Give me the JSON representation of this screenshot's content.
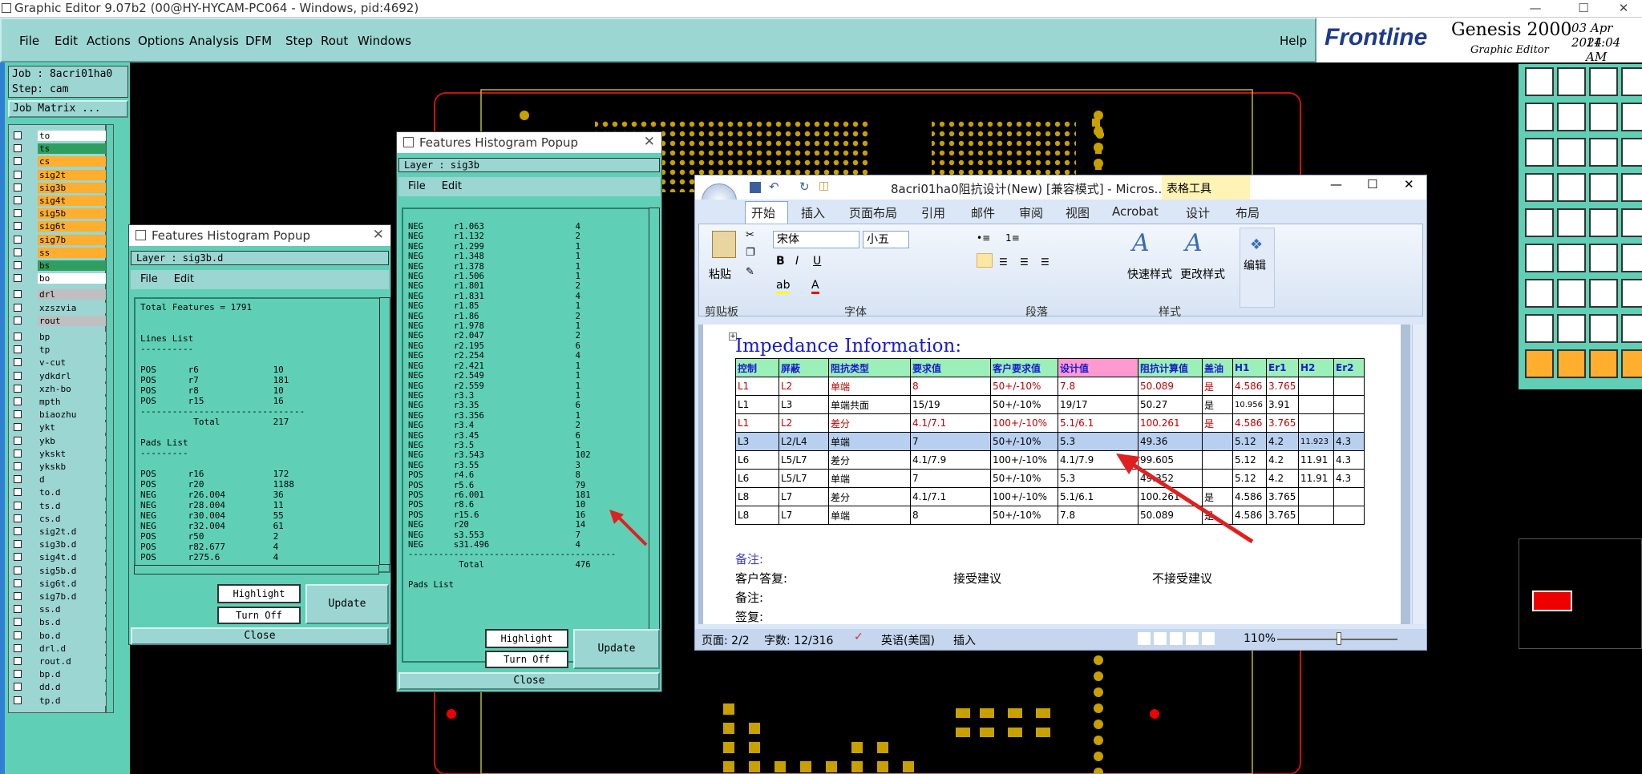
{
  "window": {
    "title": "Graphic Editor 9.07b2 (00@HY-HYCAM-PC064 - Windows, pid:4692)"
  },
  "menu": [
    "File",
    "Edit",
    "Actions",
    "Options",
    "Analysis",
    "DFM",
    "Step",
    "Rout",
    "Windows"
  ],
  "help": "Help",
  "brand": {
    "logo": "Frontline",
    "product": "Genesis 2000",
    "sub": "Graphic Editor",
    "date": "03 Apr 2024",
    "time": "11:04 AM"
  },
  "job": {
    "job_line": "Job : 8acri01ha0",
    "step_line": "Step: cam",
    "matrix_button": "Job Matrix ..."
  },
  "layers": [
    {
      "name": "to",
      "color": "#ffffff"
    },
    {
      "name": "ts",
      "color": "#2e9f60"
    },
    {
      "name": "cs",
      "color": "#ffae2e"
    },
    {
      "name": "sig2t",
      "color": "#ffae2e"
    },
    {
      "name": "sig3b",
      "color": "#ffae2e"
    },
    {
      "name": "sig4t",
      "color": "#ffae2e"
    },
    {
      "name": "sig5b",
      "color": "#ffae2e"
    },
    {
      "name": "sig6t",
      "color": "#ffae2e"
    },
    {
      "name": "sig7b",
      "color": "#ffae2e"
    },
    {
      "name": "ss",
      "color": "#ffae2e"
    },
    {
      "name": "bs",
      "color": "#2e9f60"
    },
    {
      "name": "bo",
      "color": "#ffffff"
    },
    {
      "name": "drl",
      "color": "#bfbfbf"
    },
    {
      "name": "xzszvia",
      "color": "#9bd6d3"
    },
    {
      "name": "rout",
      "color": "#bfbfbf"
    },
    {
      "name": "bp",
      "color": "#9bd6d3"
    },
    {
      "name": "tp",
      "color": "#9bd6d3"
    },
    {
      "name": "v-cut",
      "color": "#9bd6d3"
    },
    {
      "name": "ydkdrl",
      "color": "#9bd6d3"
    },
    {
      "name": "xzh-bo",
      "color": "#9bd6d3"
    },
    {
      "name": "mpth",
      "color": "#9bd6d3"
    },
    {
      "name": "biaozhu",
      "color": "#9bd6d3"
    },
    {
      "name": "ykt",
      "color": "#9bd6d3"
    },
    {
      "name": "ykb",
      "color": "#9bd6d3"
    },
    {
      "name": "ykskt",
      "color": "#9bd6d3"
    },
    {
      "name": "ykskb",
      "color": "#9bd6d3"
    },
    {
      "name": "d",
      "color": "#9bd6d3"
    },
    {
      "name": "to.d",
      "color": "#9bd6d3"
    },
    {
      "name": "ts.d",
      "color": "#9bd6d3"
    },
    {
      "name": "cs.d",
      "color": "#9bd6d3"
    },
    {
      "name": "sig2t.d",
      "color": "#9bd6d3"
    },
    {
      "name": "sig3b.d",
      "color": "#9bd6d3"
    },
    {
      "name": "sig4t.d",
      "color": "#9bd6d3"
    },
    {
      "name": "sig5b.d",
      "color": "#9bd6d3"
    },
    {
      "name": "sig6t.d",
      "color": "#9bd6d3"
    },
    {
      "name": "sig7b.d",
      "color": "#9bd6d3"
    },
    {
      "name": "ss.d",
      "color": "#9bd6d3"
    },
    {
      "name": "bs.d",
      "color": "#9bd6d3"
    },
    {
      "name": "bo.d",
      "color": "#9bd6d3"
    },
    {
      "name": "drl.d",
      "color": "#9bd6d3"
    },
    {
      "name": "rout.d",
      "color": "#9bd6d3"
    },
    {
      "name": "bp.d",
      "color": "#9bd6d3"
    },
    {
      "name": "dd.d",
      "color": "#9bd6d3"
    },
    {
      "name": "tp.d",
      "color": "#9bd6d3"
    }
  ],
  "popup1": {
    "title": "Features Histogram Popup",
    "layer": "Layer :  sig3b.d",
    "file": "File",
    "edit": "Edit",
    "content": "Total Features = 1791\n\n\nLines List\n----------\n\nPOS      r6              10\nPOS      r7              181\nPOS      r8              10\nPOS      r15             16\n-------------------------------\n          Total          217\n\nPads List\n---------\n\nPOS      r16             172\nPOS      r20             1188\nNEG      r26.004         36\nNEG      r28.004         11\nNEG      r30.004         55\nNEG      r32.004         61\nPOS      r50             2\nPOS      r82.677         4\nPOS      r275.6          4",
    "highlight": "Highlight",
    "turnoff": "Turn Off",
    "update": "Update",
    "close": "Close"
  },
  "popup2": {
    "title": "Features Histogram Popup",
    "layer": "Layer :  sig3b",
    "file": "File",
    "edit": "Edit",
    "content": "NEG      r1.063                  4\nNEG      r1.132                  2\nNEG      r1.299                  1\nNEG      r1.348                  1\nNEG      r1.378                  1\nNEG      r1.506                  1\nNEG      r1.801                  2\nNEG      r1.831                  4\nNEG      r1.85                   1\nNEG      r1.86                   2\nNEG      r1.978                  1\nNEG      r2.047                  2\nNEG      r2.195                  6\nNEG      r2.254                  4\nNEG      r2.421                  1\nNEG      r2.549                  1\nNEG      r2.559                  1\nNEG      r3.3                    1\nNEG      r3.35                   6\nNEG      r3.356                  1\nNEG      r3.4                    2\nNEG      r3.45                   6\nNEG      r3.5                    1\nNEG      r3.543                  102\nNEG      r3.55                   3\nPOS      r4.6                    8\nPOS      r5.6                    79\nPOS      r6.001                  181\nPOS      r8.6                    10\nPOS      r15.6                   16\nNEG      r20                     14\nNEG      s3.553                  7\nNEG      s31.496                 4\n-----------------------------------------\n          Total                  476\n\nPads List",
    "highlight": "Highlight",
    "turnoff": "Turn Off",
    "update": "Update",
    "close": "Close"
  },
  "word": {
    "title": "8acri01ha0阻抗设计(New) [兼容模式] - Micros...",
    "context_tab": "表格工具",
    "tabs": [
      "开始",
      "插入",
      "页面布局",
      "引用",
      "邮件",
      "审阅",
      "视图",
      "Acrobat",
      "设计",
      "布局"
    ],
    "font_name": "宋体",
    "font_size": "小五",
    "paste": "粘贴",
    "quick_style": "快速样式",
    "change_style": "更改样式",
    "edit_label": "编辑",
    "groups": [
      "剪贴板",
      "字体",
      "段落",
      "样式"
    ],
    "heading": "Impedance Information:",
    "table_headers": [
      "控制",
      "屏蔽",
      "阻抗类型",
      "要求值",
      "客户要求值",
      "设计值",
      "阻抗计算值",
      "盖油",
      "H1",
      "Er1",
      "H2",
      "Er2"
    ],
    "table_rows": [
      [
        "L1",
        "L2",
        "单端",
        "8",
        "50+/-10%",
        "7.8",
        "50.089",
        "是",
        "4.586",
        "3.765",
        "",
        ""
      ],
      [
        "L1",
        "L3",
        "单端共面",
        "15/19",
        "50+/-10%",
        "19/17",
        "50.27",
        "是",
        "10.956",
        "3.91",
        "",
        ""
      ],
      [
        "L1",
        "L2",
        "差分",
        "4.1/7.1",
        "100+/-10%",
        "5.1/6.1",
        "100.261",
        "是",
        "4.586",
        "3.765",
        "",
        ""
      ],
      [
        "L3",
        "L2/L4",
        "单端",
        "7",
        "50+/-10%",
        "5.3",
        "49.36",
        "",
        "5.12",
        "4.2",
        "11.923",
        "4.3"
      ],
      [
        "L6",
        "L5/L7",
        "差分",
        "4.1/7.9",
        "100+/-10%",
        "4.1/7.9",
        "99.605",
        "",
        "5.12",
        "4.2",
        "11.91",
        "4.3"
      ],
      [
        "L6",
        "L5/L7",
        "单端",
        "7",
        "50+/-10%",
        "5.3",
        "49.352",
        "",
        "5.12",
        "4.2",
        "11.91",
        "4.3"
      ],
      [
        "L8",
        "L7",
        "差分",
        "4.1/7.1",
        "100+/-10%",
        "5.1/6.1",
        "100.261",
        "是",
        "4.586",
        "3.765",
        "",
        ""
      ],
      [
        "L8",
        "L7",
        "单端",
        "8",
        "50+/-10%",
        "7.8",
        "50.089",
        "是",
        "4.586",
        "3.765",
        "",
        ""
      ]
    ],
    "note1": "备注:",
    "reply": "客户答复:",
    "accept": "接受建议",
    "reject": "不接受建议",
    "note2": "备注:",
    "sign": "签复:",
    "status": {
      "page": "页面: 2/2",
      "words": "字数: 12/316",
      "lang": "英语(美国)",
      "mode": "插入",
      "zoom": "110%"
    }
  },
  "colors": {
    "teal_bg": "#5fd0b6",
    "menu_bg": "#9bd6d3",
    "gold_pad": "#c8a000",
    "red_arrow": "#e02020"
  }
}
